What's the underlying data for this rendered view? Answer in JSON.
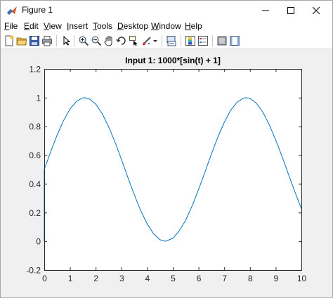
{
  "window": {
    "title": "Figure 1",
    "minimize_glyph": "—",
    "maximize_glyph": "☐",
    "close_glyph": "✕"
  },
  "menu": {
    "items": [
      {
        "first": "F",
        "rest": "ile"
      },
      {
        "first": "E",
        "rest": "dit"
      },
      {
        "first": "V",
        "rest": "iew"
      },
      {
        "first": "I",
        "rest": "nsert"
      },
      {
        "first": "T",
        "rest": "ools"
      },
      {
        "first": "D",
        "rest": "esktop"
      },
      {
        "first": "W",
        "rest": "indow"
      },
      {
        "first": "H",
        "rest": "elp"
      }
    ]
  },
  "toolbar": {
    "icons": [
      "new-figure-icon",
      "open-file-icon",
      "save-icon",
      "print-icon",
      "edit-plot-icon",
      "zoom-in-icon",
      "zoom-out-icon",
      "pan-icon",
      "rotate-3d-icon",
      "data-cursor-icon",
      "brush-icon",
      "brush-dropdown-icon",
      "link-plot-icon",
      "insert-colorbar-icon",
      "insert-legend-icon",
      "hide-plot-tools-icon",
      "show-plot-tools-icon"
    ]
  },
  "colors": {
    "line": "#0072bd",
    "axes_text": "#262626",
    "axes_box": "#262626"
  },
  "chart_data": {
    "type": "line",
    "title": "Input 1: 1000*[sin(t) + 1]",
    "xlabel": "",
    "ylabel": "",
    "xlim": [
      0,
      10
    ],
    "ylim": [
      -0.2,
      1.2
    ],
    "x_ticks": [
      "0",
      "1",
      "2",
      "3",
      "4",
      "5",
      "6",
      "7",
      "8",
      "9",
      "10"
    ],
    "y_ticks": [
      "-0.2",
      "0",
      "0.2",
      "0.4",
      "0.6",
      "0.8",
      "1",
      "1.2"
    ],
    "grid": false,
    "series": [
      {
        "x": [
          0,
          0,
          0.25,
          0.5,
          0.75,
          1.0,
          1.25,
          1.5,
          1.5708,
          1.75,
          2.0,
          2.25,
          2.5,
          2.75,
          3.0,
          3.25,
          3.5,
          3.75,
          4.0,
          4.25,
          4.5,
          4.7124,
          5.0,
          5.25,
          5.5,
          5.75,
          6.0,
          6.25,
          6.5,
          6.75,
          7.0,
          7.25,
          7.5,
          7.75,
          7.854,
          8.0,
          8.25,
          8.5,
          8.75,
          9.0,
          9.25,
          9.5,
          9.75,
          10.0
        ],
        "y": [
          0,
          0.5,
          0.624,
          0.74,
          0.841,
          0.921,
          0.974,
          0.999,
          1.0,
          0.992,
          0.955,
          0.889,
          0.799,
          0.691,
          0.571,
          0.446,
          0.325,
          0.214,
          0.122,
          0.053,
          0.011,
          0.0,
          0.021,
          0.073,
          0.147,
          0.246,
          0.36,
          0.483,
          0.608,
          0.725,
          0.828,
          0.912,
          0.969,
          0.997,
          1.0,
          0.995,
          0.962,
          0.899,
          0.812,
          0.706,
          0.589,
          0.465,
          0.344,
          0.228
        ]
      }
    ]
  }
}
